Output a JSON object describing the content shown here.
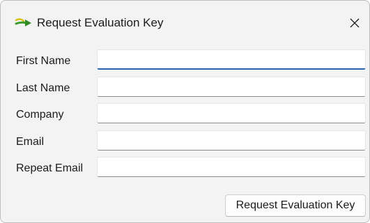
{
  "window": {
    "title": "Request Evaluation Key",
    "icon": "green-arrow-icon",
    "close_icon": "close-icon"
  },
  "form": {
    "fields": [
      {
        "label": "First Name",
        "value": "",
        "focused": true
      },
      {
        "label": "Last Name",
        "value": "",
        "focused": false
      },
      {
        "label": "Company",
        "value": "",
        "focused": false
      },
      {
        "label": "Email",
        "value": "",
        "focused": false
      },
      {
        "label": "Repeat Email",
        "value": "",
        "focused": false
      }
    ],
    "submit_label": "Request Evaluation Key"
  },
  "colors": {
    "focus_accent": "#2a64b0",
    "window_background": "#f3f3f3",
    "icon_green": "#3a9a2a",
    "icon_yellow": "#d9c21b"
  }
}
